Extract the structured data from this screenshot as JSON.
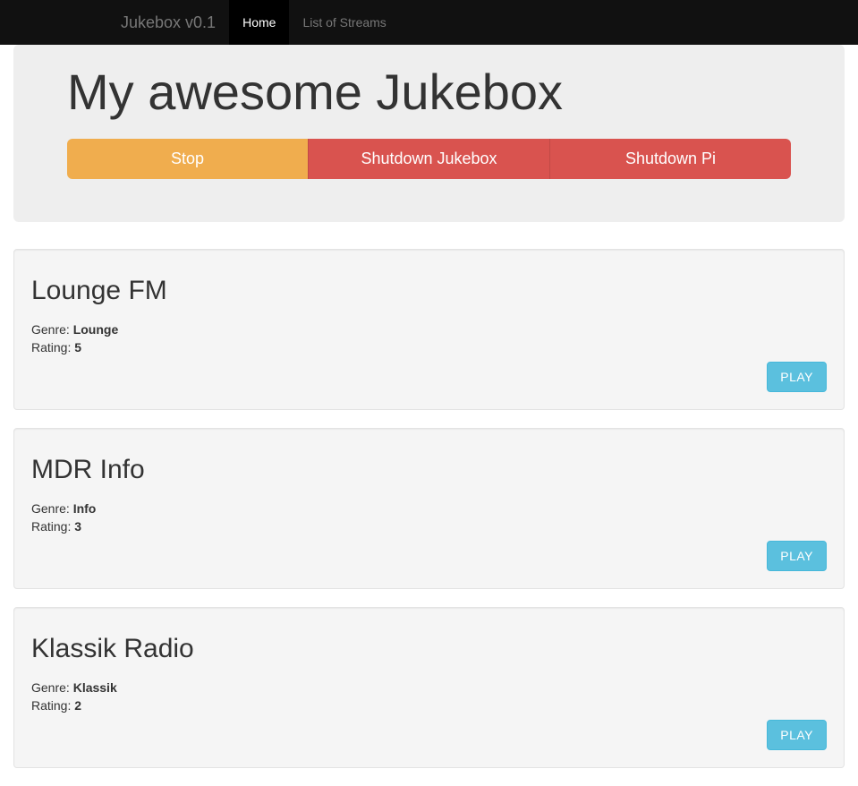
{
  "navbar": {
    "brand": "Jukebox v0.1",
    "items": [
      {
        "label": "Home",
        "active": true
      },
      {
        "label": "List of Streams",
        "active": false
      }
    ]
  },
  "header": {
    "title": "My awesome Jukebox",
    "buttons": {
      "stop": "Stop",
      "shutdown_jukebox": "Shutdown Jukebox",
      "shutdown_pi": "Shutdown Pi"
    }
  },
  "labels": {
    "genre": "Genre: ",
    "rating": "Rating: ",
    "play": "PLAY"
  },
  "streams": [
    {
      "name": "Lounge FM",
      "genre": "Lounge",
      "rating": "5"
    },
    {
      "name": "MDR Info",
      "genre": "Info",
      "rating": "3"
    },
    {
      "name": "Klassik Radio",
      "genre": "Klassik",
      "rating": "2"
    }
  ]
}
